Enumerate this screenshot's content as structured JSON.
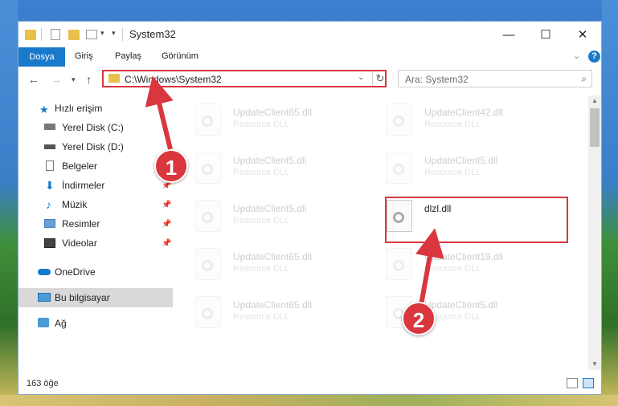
{
  "window": {
    "title": "System32",
    "controls": [
      "—",
      "☐",
      "✕"
    ]
  },
  "ribbon": {
    "tabs": [
      "Dosya",
      "Giriş",
      "Paylaş",
      "Görünüm"
    ],
    "help": "?"
  },
  "nav": {
    "address": "C:\\Windows\\System32",
    "search_placeholder": "Ara: System32"
  },
  "sidebar": {
    "items": [
      {
        "label": "Hızlı erişim",
        "icon": "star-icon"
      },
      {
        "label": "Yerel Disk (C:)",
        "icon": "drive-icon"
      },
      {
        "label": "Yerel Disk (D:)",
        "icon": "drive-icon"
      },
      {
        "label": "Belgeler",
        "icon": "documents-icon"
      },
      {
        "label": "İndirmeler",
        "icon": "download-icon"
      },
      {
        "label": "Müzik",
        "icon": "music-icon"
      },
      {
        "label": "Resimler",
        "icon": "pictures-icon"
      },
      {
        "label": "Videolar",
        "icon": "video-icon"
      },
      {
        "label": "OneDrive",
        "icon": "cloud-icon"
      },
      {
        "label": "Bu bilgisayar",
        "icon": "computer-icon"
      },
      {
        "label": "Ağ",
        "icon": "network-icon"
      }
    ]
  },
  "files": [
    {
      "name": "UpdateClient65.dll",
      "desc": "Resource DLL"
    },
    {
      "name": "UpdateClient42.dll",
      "desc": "Resource DLL"
    },
    {
      "name": "UpdateClient5.dll",
      "desc": "Resource DLL"
    },
    {
      "name": "UpdateClient5.dll",
      "desc": "Resource DLL"
    },
    {
      "name": "UpdateClient5.dll",
      "desc": "Resource DLL"
    },
    {
      "name": "dlzl.dll",
      "desc": ""
    },
    {
      "name": "UpdateClient65.dll",
      "desc": "Resource DLL"
    },
    {
      "name": "UpdateClient19.dll",
      "desc": "Resource DLL"
    },
    {
      "name": "UpdateClient65.dll",
      "desc": "Resource DLL"
    },
    {
      "name": "UpdateClient5.dll",
      "desc": "Resource DLL"
    }
  ],
  "status": {
    "count": "163 öğe"
  },
  "callouts": [
    "1",
    "2"
  ],
  "colors": {
    "accent": "#1979ca",
    "highlight": "#d9363e"
  }
}
